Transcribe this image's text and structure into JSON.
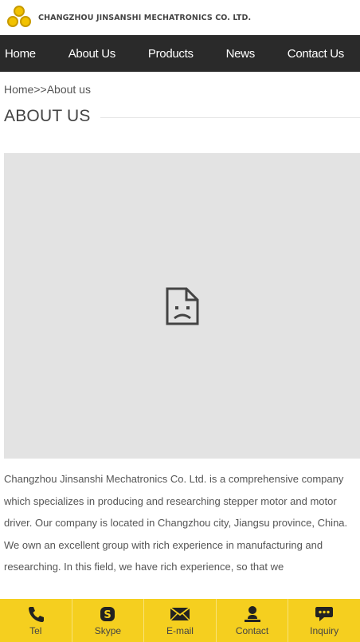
{
  "header": {
    "company_name": "CHANGZHOU JINSANSHI MECHATRONICS CO. LTD."
  },
  "nav": [
    {
      "label": "Home"
    },
    {
      "label": "About Us"
    },
    {
      "label": "Products"
    },
    {
      "label": "News"
    },
    {
      "label": "Contact Us"
    }
  ],
  "breadcrumb": "Home>>About us",
  "page_title": "ABOUT US",
  "image": {
    "state": "broken-image-icon"
  },
  "body_text": "Changzhou Jinsanshi Mechatronics Co. Ltd. is a comprehensive company which specializes in producing and researching stepper motor and motor driver. Our company is located in Changzhou city, Jiangsu province, China. We own an excellent group with rich experience in manufacturing and researching. In this field, we have rich experience, so that we",
  "bottom_bar": [
    {
      "label": "Tel",
      "icon": "phone-icon"
    },
    {
      "label": "Skype",
      "icon": "skype-icon"
    },
    {
      "label": "E-mail",
      "icon": "mail-icon"
    },
    {
      "label": "Contact",
      "icon": "person-icon"
    },
    {
      "label": "Inquiry",
      "icon": "chat-icon"
    }
  ],
  "colors": {
    "nav_bg": "#2a2a2a",
    "bottom_bar_bg": "#f5cf1f",
    "placeholder_bg": "#e3e3e3"
  }
}
